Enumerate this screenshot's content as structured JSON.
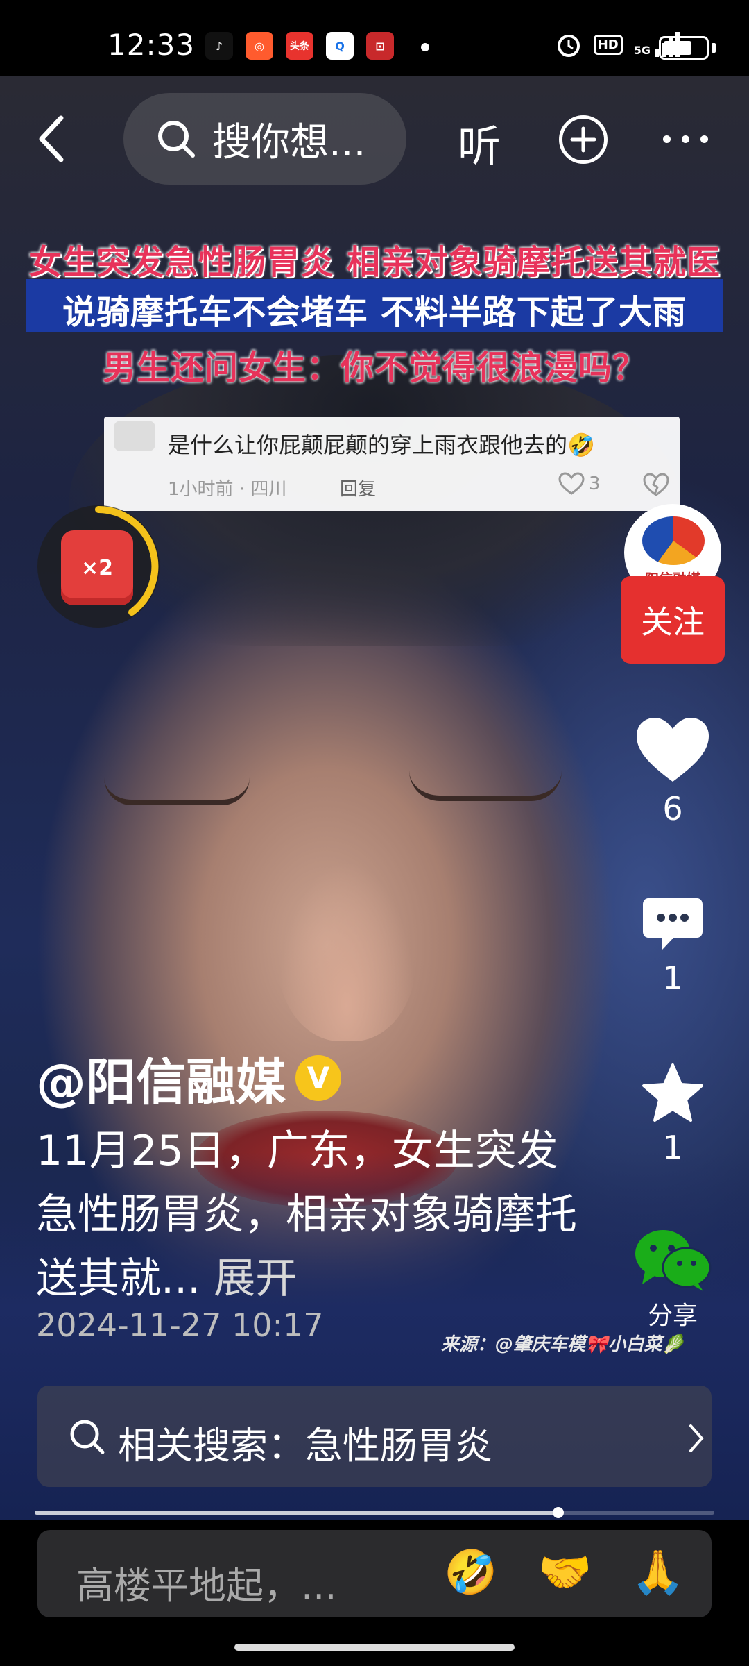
{
  "status_bar": {
    "time": "12:33",
    "hd_label": "HD",
    "network_label": "5G",
    "app_icons": [
      "douyin-icon",
      "camera-app-icon",
      "toutiao-icon",
      "search-app-icon",
      "news-app-icon"
    ],
    "toutiao_label": "头条"
  },
  "top_bar": {
    "search_placeholder": "搜你想...",
    "listen_label": "听"
  },
  "video_overlay": {
    "headline_1": "女生突发急性肠胃炎 相亲对象骑摩托送其就医",
    "headline_2": "说骑摩托车不会堵车 不料半路下起了大雨",
    "headline_3": "男生还问女生：你不觉得很浪漫吗？",
    "source_watermark": "来源：@肇庆车模🎀小白菜🥬"
  },
  "comment_card": {
    "text": "是什么让你屁颠屁颠的穿上雨衣跟他去的🤣",
    "meta": "1小时前 · 四川",
    "reply_label": "回复",
    "like_count": "3"
  },
  "red_packet": {
    "multiplier": "×2"
  },
  "publisher": {
    "logo_text": "阳信融媒",
    "follow_label": "关注"
  },
  "actions": {
    "like_count": "6",
    "comment_count": "1",
    "collect_count": "1",
    "share_label": "分享"
  },
  "post": {
    "author": "@阳信融媒",
    "verified_mark": "V",
    "caption": "11月25日，广东，女生突发急性肠胃炎，相亲对象骑摩托送其就...",
    "expand_label": " 展开",
    "date": "2024-11-27 10:17"
  },
  "related_search": {
    "label": "相关搜索：急性肠胃炎"
  },
  "playback": {
    "progress": 0.77
  },
  "comment_input": {
    "placeholder": "高楼平地起，...",
    "emojis": [
      "🤣",
      "🤝",
      "🙏"
    ]
  },
  "colors": {
    "follow_red": "#e5302f",
    "headline_red": "#e8325a",
    "headline_blue": "#1b3aa3",
    "verified_yellow": "#f7c51b"
  }
}
